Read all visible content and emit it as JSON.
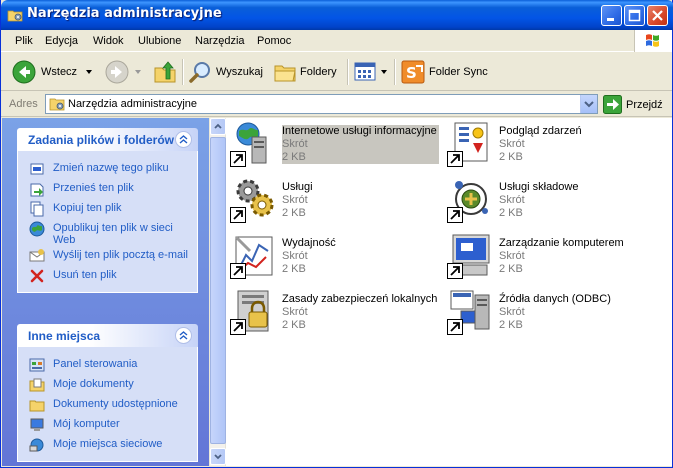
{
  "window": {
    "title": "Narzędzia administracyjne",
    "colors": {
      "titlebar": "#0a5fd8",
      "pane": "#6375d6",
      "link": "#215dc6"
    }
  },
  "menu": [
    "Plik",
    "Edycja",
    "Widok",
    "Ulubione",
    "Narzędzia",
    "Pomoc"
  ],
  "toolbar": {
    "back": "Wstecz",
    "search": "Wyszukaj",
    "folders": "Foldery",
    "folder_sync": "Folder Sync"
  },
  "address": {
    "label": "Adres",
    "value": "Narzędzia administracyjne",
    "go": "Przejdź"
  },
  "tasks_panel": {
    "title": "Zadania plików i folderów",
    "items": [
      {
        "label": "Zmień nazwę tego pliku",
        "icon": "rename-icon"
      },
      {
        "label": "Przenieś ten plik",
        "icon": "move-icon"
      },
      {
        "label": "Kopiuj ten plik",
        "icon": "copy-icon"
      },
      {
        "label": "Opublikuj ten plik w sieci Web",
        "icon": "publish-icon"
      },
      {
        "label": "Wyślij ten plik pocztą e-mail",
        "icon": "email-icon"
      },
      {
        "label": "Usuń ten plik",
        "icon": "delete-icon"
      }
    ]
  },
  "places_panel": {
    "title": "Inne miejsca",
    "items": [
      {
        "label": "Panel sterowania",
        "icon": "control-panel-icon"
      },
      {
        "label": "Moje dokumenty",
        "icon": "my-documents-icon"
      },
      {
        "label": "Dokumenty udostępnione",
        "icon": "shared-documents-icon"
      },
      {
        "label": "Mój komputer",
        "icon": "my-computer-icon"
      },
      {
        "label": "Moje miejsca sieciowe",
        "icon": "network-places-icon"
      }
    ]
  },
  "files": [
    {
      "name": "Internetowe usługi informacyjne",
      "type": "Skrót",
      "size": "2 KB",
      "icon": "iis-icon",
      "selected": true
    },
    {
      "name": "Podgląd zdarzeń",
      "type": "Skrót",
      "size": "2 KB",
      "icon": "event-viewer-icon",
      "selected": false
    },
    {
      "name": "Usługi",
      "type": "Skrót",
      "size": "2 KB",
      "icon": "services-icon",
      "selected": false
    },
    {
      "name": "Usługi składowe",
      "type": "Skrót",
      "size": "2 KB",
      "icon": "component-services-icon",
      "selected": false
    },
    {
      "name": "Wydajność",
      "type": "Skrót",
      "size": "2 KB",
      "icon": "performance-icon",
      "selected": false
    },
    {
      "name": "Zarządzanie komputerem",
      "type": "Skrót",
      "size": "2 KB",
      "icon": "computer-management-icon",
      "selected": false
    },
    {
      "name": "Zasady zabezpieczeń lokalnych",
      "type": "Skrót",
      "size": "2 KB",
      "icon": "local-security-icon",
      "selected": false
    },
    {
      "name": "Źródła danych (ODBC)",
      "type": "Skrót",
      "size": "2 KB",
      "icon": "odbc-icon",
      "selected": false
    }
  ]
}
